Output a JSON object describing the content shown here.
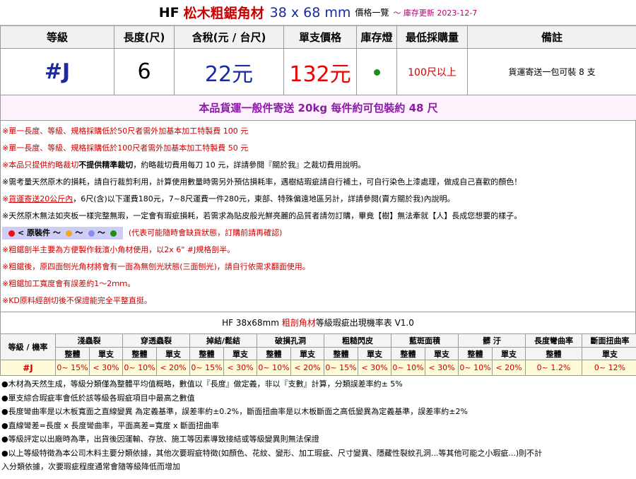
{
  "title": {
    "brand": "HF",
    "product": "松木粗鋸角材",
    "spec": "38 x 68 mm",
    "subtitle": "價格一覽",
    "update": "～ 庫存更新 2023-12-7"
  },
  "price_table": {
    "headers": [
      "等級",
      "長度(尺)",
      "含稅(元 / 台尺)",
      "單支價格",
      "庫存燈",
      "最低採購量",
      "備註"
    ],
    "grade": "#J",
    "length": "6",
    "tax_price": "22元",
    "unit_price": "132元",
    "stock_color": "#1a8f1a",
    "min_purchase": "100尺以上",
    "note": "貨運寄送一包可裝 8  支"
  },
  "shipping_line": "本品貨運一般件寄送 20kg 每件約可包裝約  48  尺",
  "notes": {
    "n1": "※單一長度、等級、規格採購低於50尺者需外加基本加工特製費 100 元",
    "n2": "※單一長度、等級、規格採購低於100尺者需外加基本加工特製費 50 元",
    "n3a": "※本品只提供約略裁切",
    "n3b": "不提供精準裁切",
    "n3c": "，約略裁切費用每刀 10 元，詳請參閱『關於我』之裁切費用說明。",
    "n4": "※需考量天然原木的損耗，請自行裁剪利用，計算使用數量時需另外預估損耗率，遇樹結瑕疵請自行補土，可自行染色上漆處理，做成自己喜歡的顏色！",
    "n5a": "※",
    "n5b": "貨運寄送20公斤內",
    "n5c": "，6尺(含)以下運費180元，7~8尺運費一件280元，東部、特殊偏遠地區另計，詳請參閱(賣方關於我)內說明。",
    "n6": "※天然原木無法如夾板一樣完整無瑕，一定會有瑕疵損耗，若需求為貼皮般光鮮亮麗的品質者請勿訂購，畢竟【樹】無法牽就【人】長成您想要的樣子。",
    "legend_label": "< 原裝件  ～",
    "legend_sep": "～",
    "legend_dot_colors": [
      "#ee1111",
      "#f5a623",
      "#8a8af0",
      "#1a8f1a"
    ],
    "legend_note": "(代表可能隨時會缺貨狀態，訂購前請再確認)",
    "n8": "※粗鋸剖半主要為方便製作栽濱小角材使用，以2x 6\" #J規格剖半。",
    "n9": "※粗鋸後，原四面刨光角材將會有一面為無刨光狀態(三面刨光)，請自行依需求翻面使用。",
    "n10": "※粗鋸加工寬度會有誤差約1～2ｍｍ。",
    "n11": "※KD原料經剖切後不保證能完全平整直挺。"
  },
  "rate_table": {
    "title_a": "HF 38x68mm",
    "title_b": "粗剖角材",
    "title_c": "等級瑕疵出現機率表 V1.0",
    "grade_header": "等級 / 機率",
    "categories": [
      "淺蟲裂",
      "穿透蟲裂",
      "掉結/鬆結",
      "破損孔洞",
      "粗糙閃皮",
      "藍斑面積",
      "髒 汙",
      "長度彎曲率",
      "斷面扭曲率"
    ],
    "sub_whole": "整體",
    "sub_single": "單支",
    "grade": "#J",
    "values": [
      "0~ 15%",
      "< 30%",
      "0~ 10%",
      "< 20%",
      "0~ 15%",
      "< 30%",
      "0~ 10%",
      "< 20%",
      "0~ 15%",
      "< 30%",
      "0~ 10%",
      "< 30%",
      "0~ 10%",
      "< 20%"
    ],
    "bend_value": "0~ 1.2%",
    "twist_value": "0~ 12%"
  },
  "footer": [
    "●木材為天然生成，等級分類僅為整體平均值概略，數值以『長度』做定義，非以『支數』計算，分類誤差率約± 5%",
    "●單支綜合瑕疵率會低於該等級各瑕疵項目中最高之數值",
    "●長度彎曲率是以木板寬面之直線變異 為定義基準，誤差率約±0.2%，斷面扭曲率是以木板斷面之高低變異為定義基準，誤差率約±2%",
    "●直線彎差=長度 x 長度彎曲率，平面高差=寬度 x 斷面扭曲率",
    "●等級評定以出廠時為準，出貨後因運輸、存放、施工等因素導致接結或等級變異則無法保證",
    "●以上等級特徵為本公司木料主要分類依據，其他次要瑕疵特徵(如顏色、花紋、變形、加工瑕疵、尺寸變異、隱藏性裂紋孔洞...等其他可能之小瑕疵...)則不計",
    "入分類依據，次要瑕疵程度通常會隨等級降低而增加"
  ]
}
